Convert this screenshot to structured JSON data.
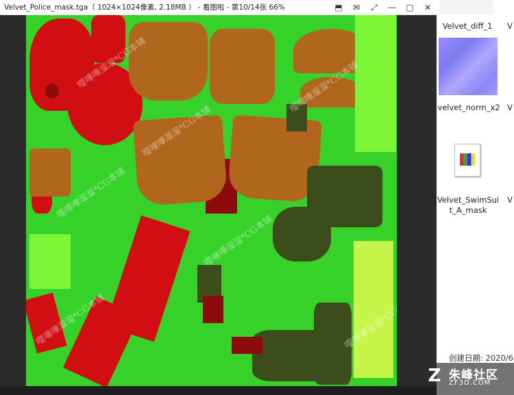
{
  "window": {
    "title": "Velvet_Police_mask.tga（ 1024×1024像素, 2.18MB ） - 看图啦 - 第10/14张 66%",
    "icons": [
      "pin-icon",
      "chat-icon",
      "fullscreen-icon",
      "minimize-icon",
      "maximize-icon",
      "close-icon"
    ],
    "icon_glyphs": [
      "⬒",
      "✉",
      "⤢",
      "—",
      "□",
      "✕"
    ]
  },
  "watermark": "嘤嘩嘩溜溜*CG本铺",
  "explorer": {
    "files": [
      {
        "name": "Velvet_diff_1"
      },
      {
        "name": "velvet_norm_x2"
      },
      {
        "name": "Velvet_SwimSuit_A_mask",
        "line1": "Velvet_SwimSui",
        "line2": "t_A_mask"
      }
    ],
    "partial_labels": [
      "V",
      "V",
      "V"
    ],
    "status": "创建日期: 2020/6"
  },
  "brand": {
    "mark": "Z",
    "name": "朱峰社区",
    "url": "ZF3D.COM"
  }
}
